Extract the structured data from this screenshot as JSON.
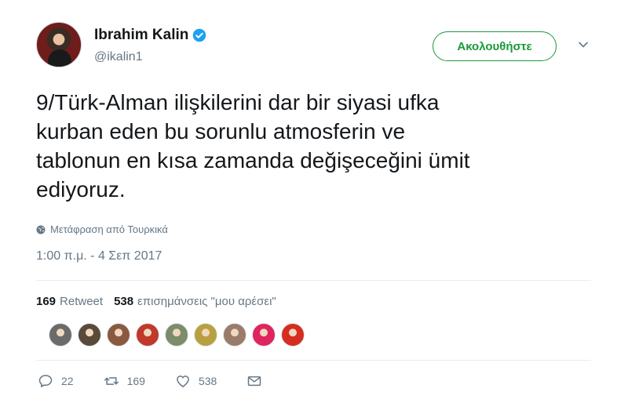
{
  "author": {
    "name": "Ibrahim Kalin",
    "handle": "@ikalin1",
    "verified": true
  },
  "follow_button": {
    "label": "Ακολουθήστε"
  },
  "tweet": {
    "lines": [
      "9/Türk-Alman ilişkilerini dar bir siyasi ufka",
      "kurban eden bu sorunlu atmosferin ve",
      "tablonun en kısa zamanda değişeceğini ümit",
      "ediyoruz."
    ],
    "translate_label": "Μετάφραση από Τουρκικά",
    "timestamp": "1:00 π.μ. - 4 Σεπ 2017"
  },
  "stats": {
    "retweets_count": "169",
    "retweets_label": "Retweet",
    "likes_count": "538",
    "likes_label": "επισημάνσεις \"μου αρέσει\""
  },
  "liker_avatars": [
    {
      "color": "#6b6b6b"
    },
    {
      "color": "#5a4a3a"
    },
    {
      "color": "#8a5a40"
    },
    {
      "color": "#c0392b"
    },
    {
      "color": "#7d8c6a"
    },
    {
      "color": "#b8a040"
    },
    {
      "color": "#9b7b6a"
    },
    {
      "color": "#e0245e"
    },
    {
      "color": "#d62d20"
    }
  ],
  "actions": {
    "reply_count": "22",
    "retweet_count": "169",
    "like_count": "538"
  },
  "colors": {
    "follow": "#1a9a3a",
    "verified": "#1da1f2",
    "muted": "#657786"
  }
}
